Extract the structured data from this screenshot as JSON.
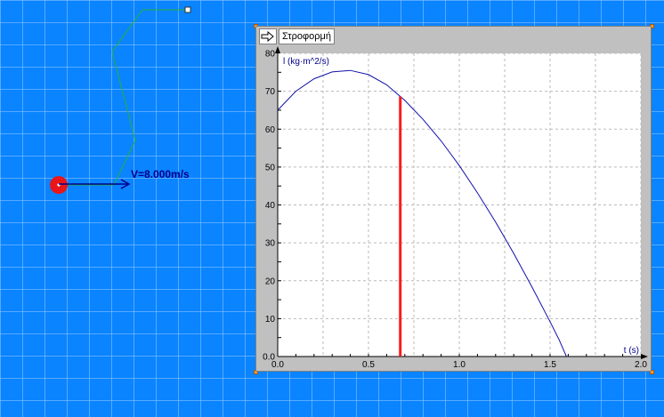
{
  "scene": {
    "velocity_label": "V=8.000m/s"
  },
  "graph_window": {
    "title": "Στροφορμή",
    "arrow_icon": "hollow-right-arrow-icon"
  },
  "colors": {
    "background": "#0a84ff",
    "curve": "#1010aa",
    "cursor": "#ff1a1a",
    "ball": "#e8161b",
    "spring": "#28b03a"
  },
  "chart_data": {
    "type": "line",
    "title": "",
    "xlabel": "t (s)",
    "ylabel": "l (kg·m^2/s)",
    "xlim": [
      0.0,
      2.0
    ],
    "ylim": [
      0,
      80
    ],
    "x_ticks": [
      "0.0",
      "0.5",
      "1.0",
      "1.5",
      "2.0"
    ],
    "y_ticks": [
      "0.0",
      "10",
      "20",
      "30",
      "40",
      "50",
      "60",
      "70",
      "80"
    ],
    "grid": true,
    "cursor_t": 0.675,
    "series": [
      {
        "x": [
          0.0,
          0.1,
          0.2,
          0.3,
          0.4,
          0.5,
          0.6,
          0.7,
          0.8,
          0.9,
          1.0,
          1.1,
          1.2,
          1.3,
          1.4,
          1.5,
          1.55,
          1.59
        ],
        "y": [
          65.0,
          70.0,
          73.3,
          75.1,
          75.5,
          74.4,
          71.7,
          67.6,
          62.6,
          56.9,
          50.4,
          43.2,
          35.5,
          27.2,
          18.4,
          9.2,
          4.4,
          0.0
        ]
      }
    ]
  }
}
